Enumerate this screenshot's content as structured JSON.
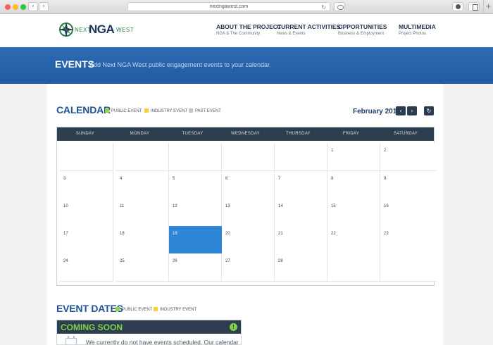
{
  "browser": {
    "url": "nextngawest.com"
  },
  "logo": {
    "pre": "NEXT",
    "main": "NGA",
    "post": "WEST"
  },
  "nav": [
    {
      "title": "ABOUT THE PROJECT",
      "sub": "NGA & The Community"
    },
    {
      "title": "CURRENT ACTIVITIES",
      "sub": "News & Events"
    },
    {
      "title": "OPPORTUNITIES",
      "sub": "Business & Employment"
    },
    {
      "title": "MULTIMEDIA",
      "sub": "Project Photos"
    }
  ],
  "banner": {
    "title": "EVENTS",
    "subtitle": "Add Next NGA West public engagement events to your calendar."
  },
  "calendar": {
    "title": "CALENDAR",
    "legend": [
      {
        "label": "PUBLIC EVENT",
        "color": "#8fd14f"
      },
      {
        "label": "INDUSTRY EVENT",
        "color": "#f2d23c"
      },
      {
        "label": "PAST EVENT",
        "color": "#bfc6cd"
      }
    ],
    "month": "February 2019",
    "weekdays": [
      "SUNDAY",
      "MONDAY",
      "TUESDAY",
      "WEDNESDAY",
      "THURSDAY",
      "FRIDAY",
      "SATURDAY"
    ],
    "weeks": [
      [
        "",
        "",
        "",
        "",
        "",
        "1",
        "2"
      ],
      [
        "3",
        "4",
        "5",
        "6",
        "7",
        "8",
        "9"
      ],
      [
        "10",
        "11",
        "12",
        "13",
        "14",
        "15",
        "16"
      ],
      [
        "17",
        "18",
        "19",
        "20",
        "21",
        "22",
        "23"
      ],
      [
        "24",
        "25",
        "26",
        "27",
        "28",
        "",
        ""
      ]
    ],
    "today": "19",
    "highlight_color": "#2e86d6"
  },
  "event_dates": {
    "title": "EVENT DATES",
    "legend": [
      {
        "label": "PUBLIC EVENT",
        "color": "#8fd14f"
      },
      {
        "label": "INDUSTRY EVENT",
        "color": "#f2d23c"
      }
    ],
    "card_title": "COMING SOON",
    "card_text": "We currently do not have events scheduled. Our calendar"
  },
  "icons": {
    "prev": "chevron-left-icon",
    "next": "chevron-right-icon",
    "refresh": "refresh-icon",
    "info": "info-icon",
    "calendar": "calendar-icon"
  }
}
